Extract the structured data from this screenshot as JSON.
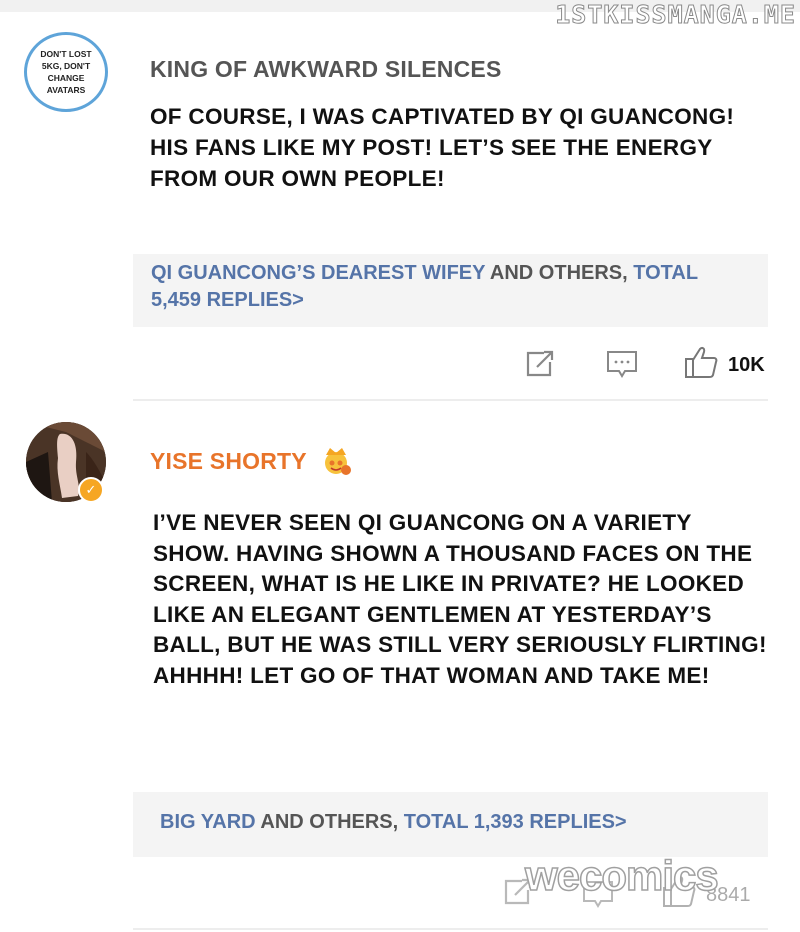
{
  "site_watermark": "1STKISSMANGA.ME",
  "bottom_watermark": "wecomics",
  "posts": [
    {
      "avatar_text": "DON'T LOST 5KG, DON'T CHANGE AVATARS",
      "username": "KING OF AWKWARD SILENCES",
      "text": "OF COURSE, I WAS CAPTIVATED BY QI GUANCONG! HIS FANS LIKE MY POST! LET’S SEE THE ENERGY FROM OUR OWN PEOPLE!",
      "replies": {
        "first_name": "QI GUANCONG’S DEAREST WIFEY",
        "middle": " AND OTHERS, ",
        "total": "TOTAL 5,459 REPLIES>"
      },
      "likes": "10K"
    },
    {
      "username": "YISE SHORTY",
      "verified": true,
      "text": "I’VE NEVER SEEN QI GUANCONG ON A VARIETY SHOW. HAVING SHOWN A THOUSAND FACES ON THE SCREEN, WHAT IS HE LIKE IN PRIVATE? HE LOOKED LIKE AN ELEGANT GENTLEMEN AT YESTERDAY’S BALL, BUT HE WAS STILL VERY SERIOUSLY FLIRTING! AHHHH! LET GO OF THAT WOMAN AND TAKE ME!",
      "replies": {
        "first_name": "BIG YARD",
        "middle": " AND OTHERS, ",
        "total": "TOTAL 1,393 REPLIES>"
      },
      "likes": "8841"
    }
  ],
  "colors": {
    "link": "#5574a8",
    "username_highlight": "#e8742a",
    "verify_badge": "#f6a623"
  },
  "icons": [
    "share-icon",
    "comment-icon",
    "thumbs-up-icon",
    "crown-emoji-icon",
    "verified-icon"
  ]
}
